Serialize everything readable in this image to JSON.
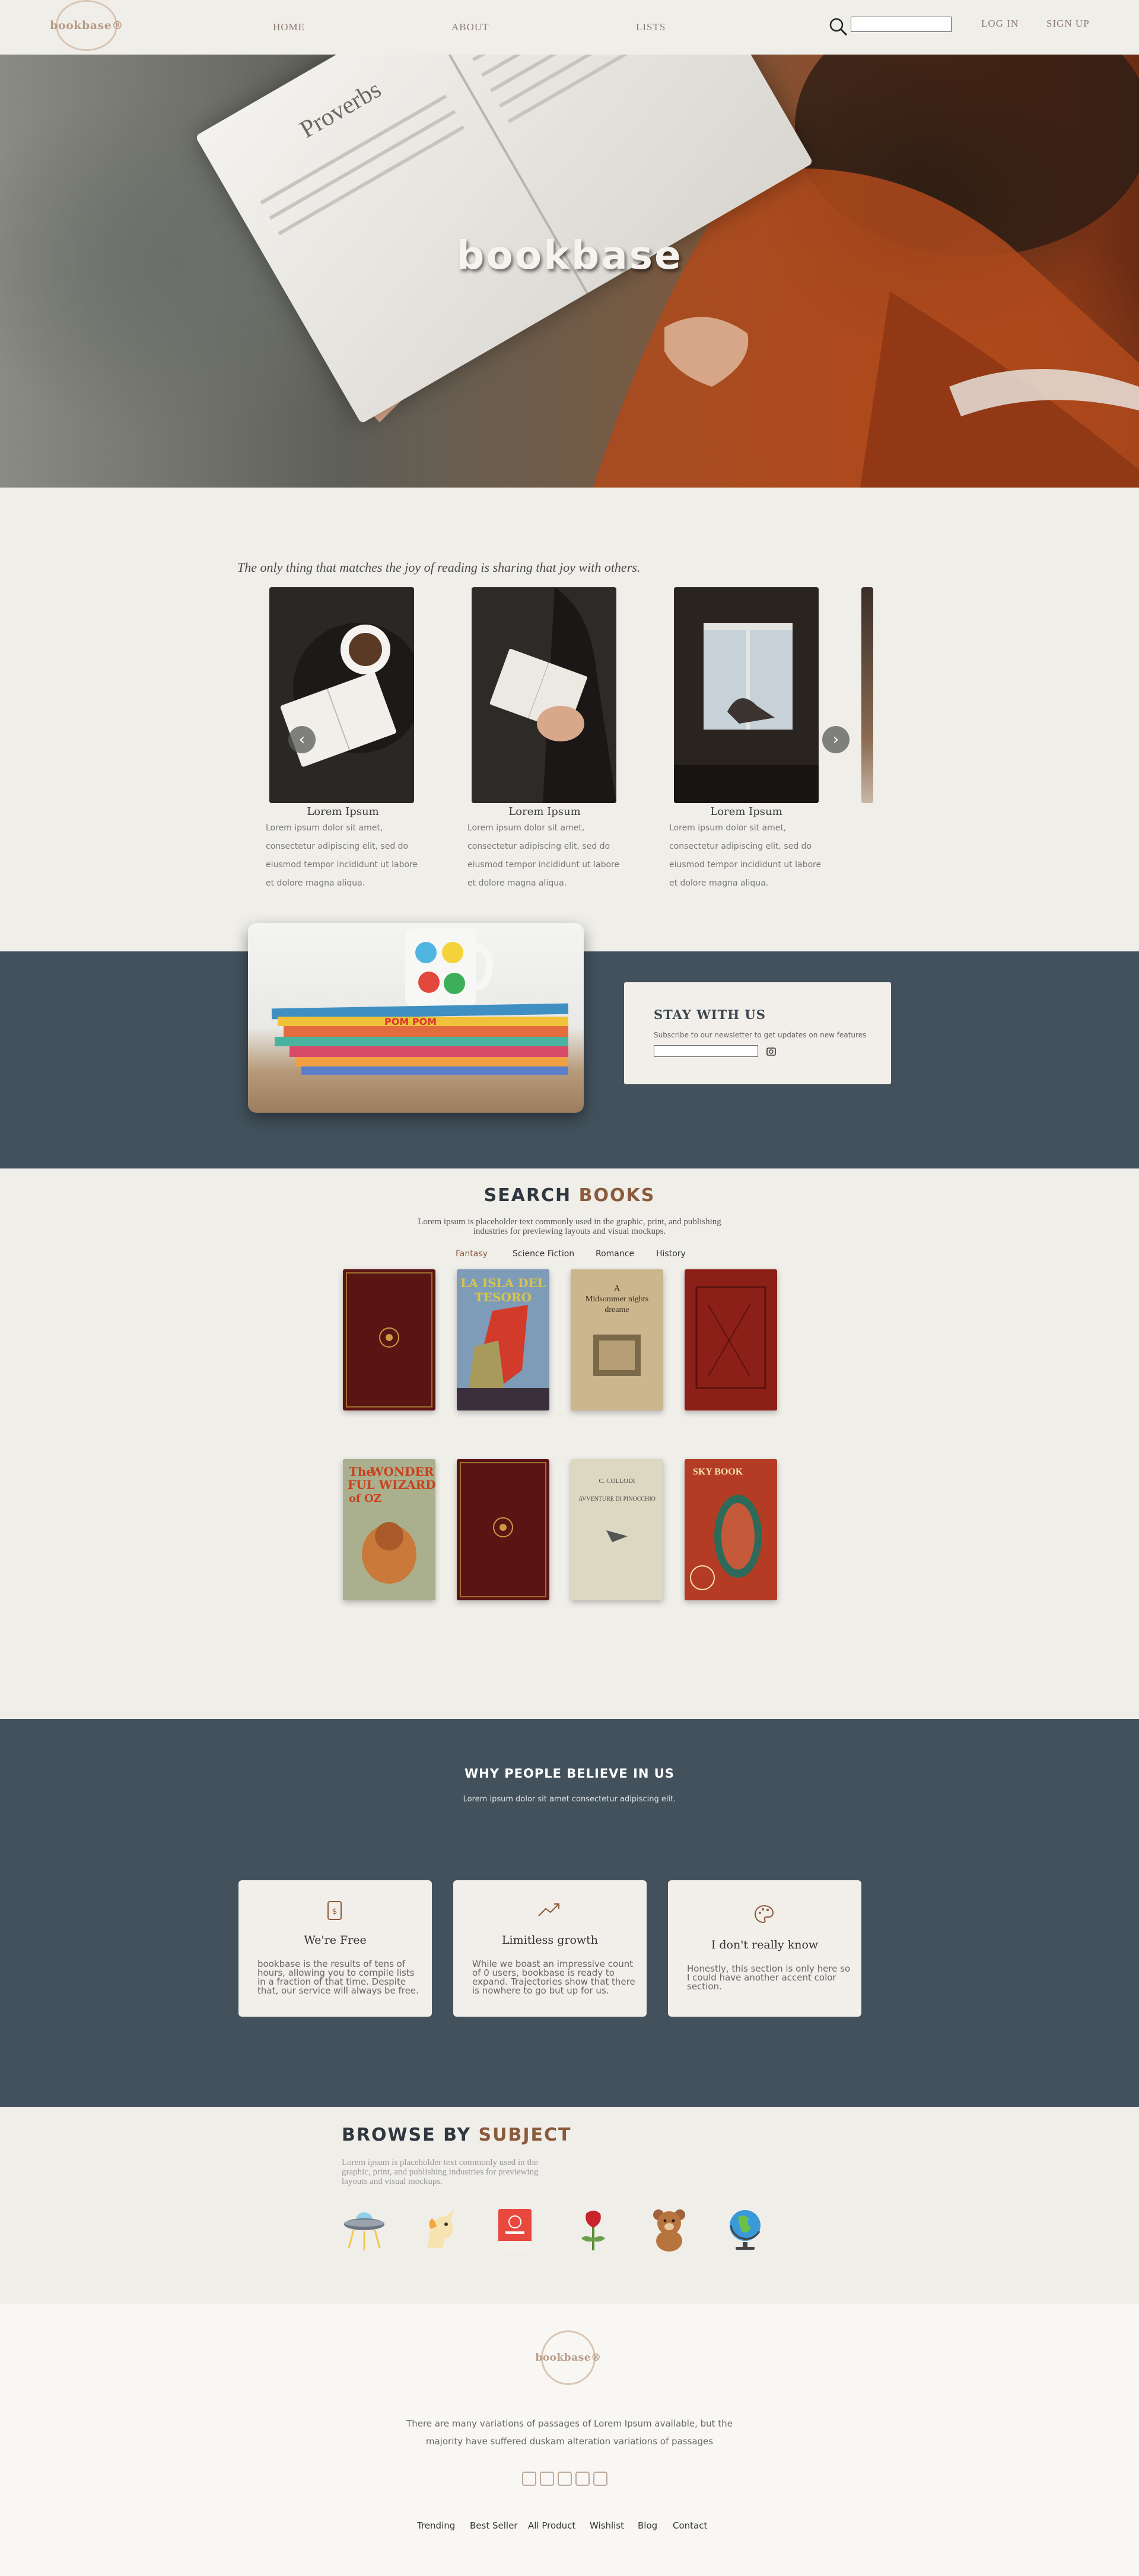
{
  "nav": {
    "logo": "bookbase®",
    "links": [
      "HOME",
      "ABOUT",
      "LISTS"
    ],
    "search_placeholder": "",
    "login": "LOG IN",
    "signup": "SIGN UP"
  },
  "hero": {
    "title": "bookbase",
    "book_heading": "Proverbs"
  },
  "intro": {
    "tagline": "The only thing that matches the joy of reading is sharing that joy with others.",
    "cards": [
      {
        "title": "Lorem Ipsum",
        "text": [
          "Lorem ipsum dolor sit amet,",
          "consectetur adipiscing elit, sed do",
          "eiusmod tempor incididunt ut labore",
          "et dolore magna aliqua."
        ]
      },
      {
        "title": "Lorem Ipsum",
        "text": [
          "Lorem ipsum dolor sit amet,",
          "consectetur adipiscing elit, sed do",
          "eiusmod tempor incididunt ut labore",
          "et dolore magna aliqua."
        ]
      },
      {
        "title": "Lorem Ipsum",
        "text": [
          "Lorem ipsum dolor sit amet,",
          "consectetur adipiscing elit, sed do",
          "eiusmod tempor incididunt ut labore",
          "et dolore magna aliqua."
        ]
      }
    ],
    "prev_icon": "chevron-left-icon",
    "next_icon": "chevron-right-icon"
  },
  "newsletter": {
    "title": "STAY WITH US",
    "subtitle": "Subscribe to our newsletter to get updates on new features",
    "email_placeholder": "",
    "mug_text": "POM POM"
  },
  "search_books": {
    "title_a": "SEARCH ",
    "title_b": "BOOKS",
    "subtitle": [
      "Lorem ipsum is placeholder text commonly used in the graphic, print, and publishing",
      "industries for previewing layouts and visual mockups."
    ],
    "genres": [
      "Fantasy",
      "Science Fiction",
      "Romance",
      "History"
    ],
    "active_genre": "Fantasy",
    "covers": {
      "c2": [
        "LA ISLA DEL",
        "TESORO"
      ],
      "c3": [
        "A",
        "Midsommer nights",
        "dreame"
      ],
      "c5": [
        "The",
        "WONDER",
        "FUL WIZARD",
        "of OZ"
      ],
      "c7": [
        "C. COLLODI",
        "AVVENTURE DI PINOCCHIO"
      ],
      "c8": [
        "SKY BOOK"
      ]
    }
  },
  "why": {
    "title": "WHY PEOPLE BELIEVE IN US",
    "subtitle": "Lorem ipsum dolor sit amet consectetur adipiscing elit.",
    "features": [
      {
        "icon": "dollar-document-icon",
        "title": "We're Free",
        "text": [
          "bookbase is the results of tens of",
          "hours, allowing you to compile lists",
          "in a fraction of that time. Despite",
          "that, our service will always be free."
        ]
      },
      {
        "icon": "trending-up-icon",
        "title": "Limitless growth",
        "text": [
          "While we boast an impressive count",
          "of 0 users, bookbase is ready to",
          "expand. Trajectories show that there",
          "is nowhere to go but up for us."
        ]
      },
      {
        "icon": "palette-icon",
        "title": "I don't really know",
        "text": [
          "Honestly, this section is only here so",
          "I could have another accent color",
          "section."
        ]
      }
    ]
  },
  "subject": {
    "title_a": "BROWSE BY ",
    "title_b": "SUBJECT",
    "subtitle": [
      "Lorem ipsum is placeholder text commonly used in the",
      "graphic, print, and publishing industries for previewing",
      "layouts and visual mockups."
    ],
    "icons": [
      "ufo-icon",
      "unicorn-icon",
      "book-icon",
      "rose-icon",
      "teddy-bear-icon",
      "globe-icon"
    ]
  },
  "footer": {
    "logo": "bookbase®",
    "text": [
      "There are many variations of passages of Lorem Ipsum available, but the",
      "majority have suffered duskam alteration variations of passages"
    ],
    "social_icons": [
      "github-icon",
      "linkedin-icon",
      "instagram-icon",
      "twitter-icon",
      "share-icon"
    ],
    "links": [
      "Trending",
      "Best Seller",
      "All Product",
      "Wishlist",
      "Blog",
      "Contact"
    ]
  },
  "colors": {
    "accent": "#8b5a3c",
    "band": "#42515c",
    "background": "#f0eee9"
  }
}
